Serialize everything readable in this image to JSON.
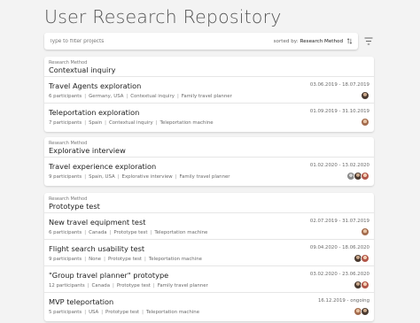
{
  "page": {
    "title": "User Research Repository"
  },
  "filter": {
    "placeholder": "Type to filter projects",
    "sort_prefix": "sorted by:",
    "sort_value": "Research Method"
  },
  "groups": [
    {
      "key": "Research Method",
      "value": "Contextual inquiry",
      "items": [
        {
          "name": "Travel Agents exploration",
          "participants": "6 participants",
          "country": "Germany, USA",
          "method": "Contextual inquiry",
          "product": "Family travel planner",
          "dates": "03.06.2019 - 18.07.2019",
          "avatars": [
            "dark"
          ]
        },
        {
          "name": "Teleportation exploration",
          "participants": "7 participants",
          "country": "Spain",
          "method": "Contextual inquiry",
          "product": "Teleportation machine",
          "dates": "01.09.2019 - 31.10.2019",
          "avatars": [
            "mid"
          ]
        }
      ]
    },
    {
      "key": "Research Method",
      "value": "Explorative interview",
      "items": [
        {
          "name": "Travel experience exploration",
          "participants": "9 participants",
          "country": "Spain, USA",
          "method": "Explorative interview",
          "product": "Family travel planner",
          "dates": "01.02.2020 - 13.02.2020",
          "avatars": [
            "light",
            "dark",
            "red"
          ]
        }
      ]
    },
    {
      "key": "Research Method",
      "value": "Prototype test",
      "items": [
        {
          "name": "New travel equipment test",
          "participants": "6 participants",
          "country": "Canada",
          "method": "Prototype test",
          "product": "Teleportation machine",
          "dates": "02.07.2019 - 31.07.2019",
          "avatars": [
            "mid"
          ]
        },
        {
          "name": "Flight search usability test",
          "participants": "9 participants",
          "country": "None",
          "method": "Prototype test",
          "product": "Teleportation machine",
          "dates": "09.04.2020 - 18.06.2020",
          "avatars": [
            "dark",
            "red"
          ]
        },
        {
          "name": "\"Group travel planner\" prototype",
          "participants": "12 participants",
          "country": "Canada",
          "method": "Prototype test",
          "product": "Family travel planner",
          "dates": "03.02.2020 - 23.06.2020",
          "avatars": [
            "dark",
            "red"
          ]
        },
        {
          "name": "MVP teleportation",
          "participants": "5 participants",
          "country": "USA",
          "method": "Prototype test",
          "product": "Teleportation machine",
          "dates": "16.12.2019 - ongoing",
          "avatars": [
            "mid",
            "dark"
          ]
        }
      ]
    }
  ]
}
